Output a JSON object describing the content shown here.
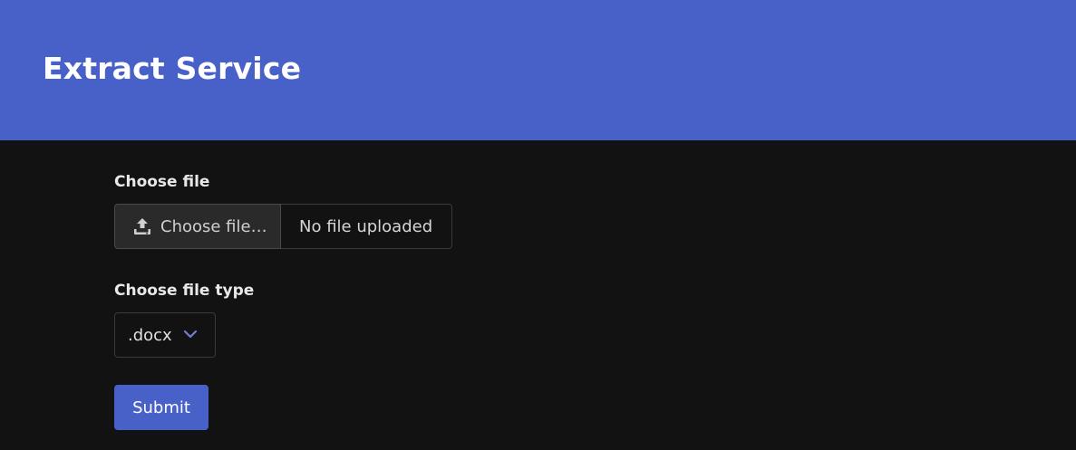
{
  "header": {
    "title": "Extract Service",
    "background_color": "#4861c9"
  },
  "form": {
    "file_label": "Choose file",
    "file_button": {
      "label": "Choose file…",
      "icon": "upload-icon"
    },
    "file_name": "No file uploaded",
    "file_type_label": "Choose file type",
    "file_type_select": {
      "selected": ".docx",
      "icon": "chevron-down-icon",
      "chevron_color": "#6f7fd6"
    },
    "submit_label": "Submit"
  },
  "colors": {
    "accent": "#4861c9",
    "page_background": "#121212"
  }
}
